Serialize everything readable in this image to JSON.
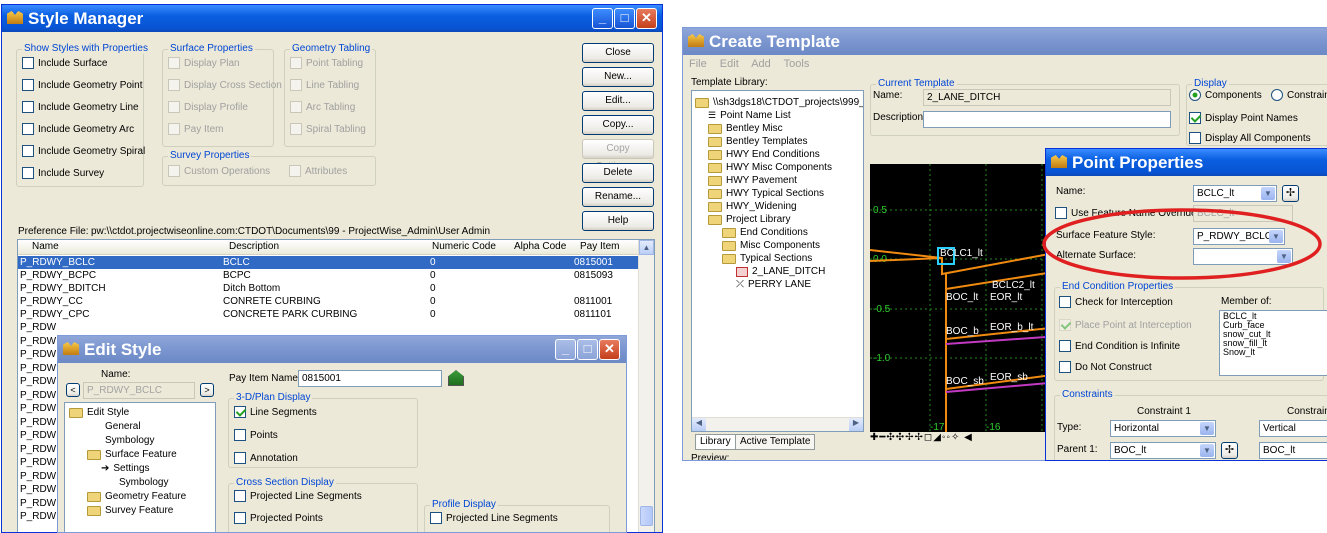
{
  "style_manager": {
    "title": "Style Manager",
    "show_styles": {
      "label": "Show Styles with Properties",
      "items": [
        "Include Surface",
        "Include Geometry Point",
        "Include Geometry Line",
        "Include Geometry Arc",
        "Include Geometry Spiral",
        "Include Survey"
      ]
    },
    "surface_props": {
      "label": "Surface Properties",
      "items": [
        "Display Plan",
        "Display Cross Section",
        "Display Profile",
        "Pay Item"
      ]
    },
    "geometry_tabling": {
      "label": "Geometry Tabling",
      "items": [
        "Point Tabling",
        "Line Tabling",
        "Arc Tabling",
        "Spiral Tabling"
      ]
    },
    "survey_props": {
      "label": "Survey Properties",
      "items": [
        "Custom Operations",
        "Attributes"
      ]
    },
    "buttons": [
      "Close",
      "New...",
      "Edit...",
      "Copy...",
      "Copy Settings...",
      "Delete",
      "Rename...",
      "Help"
    ],
    "pref_label": "Preference File:",
    "pref_value": "pw:\\\\ctdot.projectwiseonline.com:CTDOT\\Documents\\99 - ProjectWise_Admin\\User Admin",
    "columns": [
      "Name",
      "Description",
      "Numeric Code",
      "Alpha Code",
      "Pay Item"
    ],
    "rows": [
      {
        "name": "P_RDWY_BCLC",
        "desc": "BCLC",
        "num": "0",
        "pay": "0815001"
      },
      {
        "name": "P_RDWY_BCPC",
        "desc": "BCPC",
        "num": "0",
        "pay": "0815093"
      },
      {
        "name": "P_RDWY_BDITCH",
        "desc": "Ditch Bottom",
        "num": "0",
        "pay": ""
      },
      {
        "name": "P_RDWY_CC",
        "desc": "CONRETE CURBING",
        "num": "0",
        "pay": "0811001"
      },
      {
        "name": "P_RDWY_CPC",
        "desc": "CONCRETE PARK CURBING",
        "num": "0",
        "pay": "0811101"
      }
    ],
    "hidden_rows": [
      "P_RDW",
      "P_RDW",
      "P_RDW",
      "P_RDW",
      "P_RDW",
      "P_RDW",
      "P_RDW",
      "P_RDW",
      "P_RDW",
      "P_RDW",
      "P_RDW",
      "P_RDW",
      "P_RDW",
      "P_RDW",
      "P_RDW"
    ]
  },
  "edit_style": {
    "title": "Edit Style",
    "name_label": "Name:",
    "name_value": "P_RDWY_BCLC",
    "tree": [
      "Edit Style",
      "General",
      "Symbology",
      "Surface Feature",
      "Settings",
      "Symbology",
      "Geometry Feature",
      "Survey Feature"
    ],
    "pay_item_label": "Pay Item Name:",
    "pay_item_value": "0815001",
    "plan_display": {
      "label": "3-D/Plan Display",
      "items": [
        "Line Segments",
        "Points",
        "Annotation"
      ]
    },
    "xs_display": {
      "label": "Cross Section Display",
      "items": [
        "Projected Line Segments",
        "Projected Points"
      ]
    },
    "profile_display": {
      "label": "Profile Display",
      "items": [
        "Projected Line Segments"
      ]
    }
  },
  "create_template": {
    "title": "Create Template",
    "menu": [
      "File",
      "Edit",
      "Add",
      "Tools"
    ],
    "library_label": "Template Library:",
    "tree": [
      "\\\\sh3dgs18\\CTDOT_projects\\999_",
      "Point Name List",
      "Bentley Misc",
      "Bentley Templates",
      "HWY End Conditions",
      "HWY Misc Components",
      "HWY Pavement",
      "HWY Typical Sections",
      "HWY_Widening",
      "Project Library",
      "End Conditions",
      "Misc Components",
      "Typical Sections",
      "2_LANE_DITCH",
      "PERRY LANE"
    ],
    "tabs": [
      "Library",
      "Active Template"
    ],
    "preview_label": "Preview:",
    "current_label": "Current Template",
    "name_label": "Name:",
    "name_value": "2_LANE_DITCH",
    "desc_label": "Description:",
    "display_label": "Display",
    "display_radio": [
      "Components",
      "Constrain"
    ],
    "display_checks": [
      "Display Point Names",
      "Display All Components"
    ],
    "canvas": {
      "y_ticks": [
        "0.5",
        "0.0",
        "-0.5",
        "-1.0"
      ],
      "x_ticks": [
        "-17",
        "-16"
      ],
      "labels": [
        "BCLC1_lt",
        "BCLC2_lt",
        "BOC_lt",
        "EOR_lt",
        "BOC_b",
        "EOR_b_lt",
        "BOC_sb",
        "EOR_sb"
      ]
    }
  },
  "point_props": {
    "title": "Point Properties",
    "name_label": "Name:",
    "name_value": "BCLC_lt",
    "override_label": "Use Feature Name Override:",
    "override_value": "BCLC_lt",
    "sfs_label": "Surface Feature Style:",
    "sfs_value": "P_RDWY_BCLC",
    "alt_label": "Alternate Surface:",
    "ecp_label": "End Condition Properties",
    "ecp_items": [
      "Check for Interception",
      "Place Point at Interception",
      "End Condition is Infinite",
      "Do Not Construct"
    ],
    "member_label": "Member of:",
    "members": [
      "BCLC_lt",
      "Curb_face",
      "snow_cut_lt",
      "snow_fill_lt",
      "Snow_lt"
    ],
    "constraints_label": "Constraints",
    "c1_label": "Constraint 1",
    "c2_label": "Constraint",
    "type_label": "Type:",
    "type1": "Horizontal",
    "type2": "Vertical",
    "parent_label": "Parent 1:",
    "parent1": "BOC_lt",
    "parent2": "BOC_lt"
  },
  "colors": {
    "title_blue": "#0a5fe0",
    "highlight": "#316ac5",
    "ellipse": "#e02020",
    "canvas": "#000000"
  }
}
